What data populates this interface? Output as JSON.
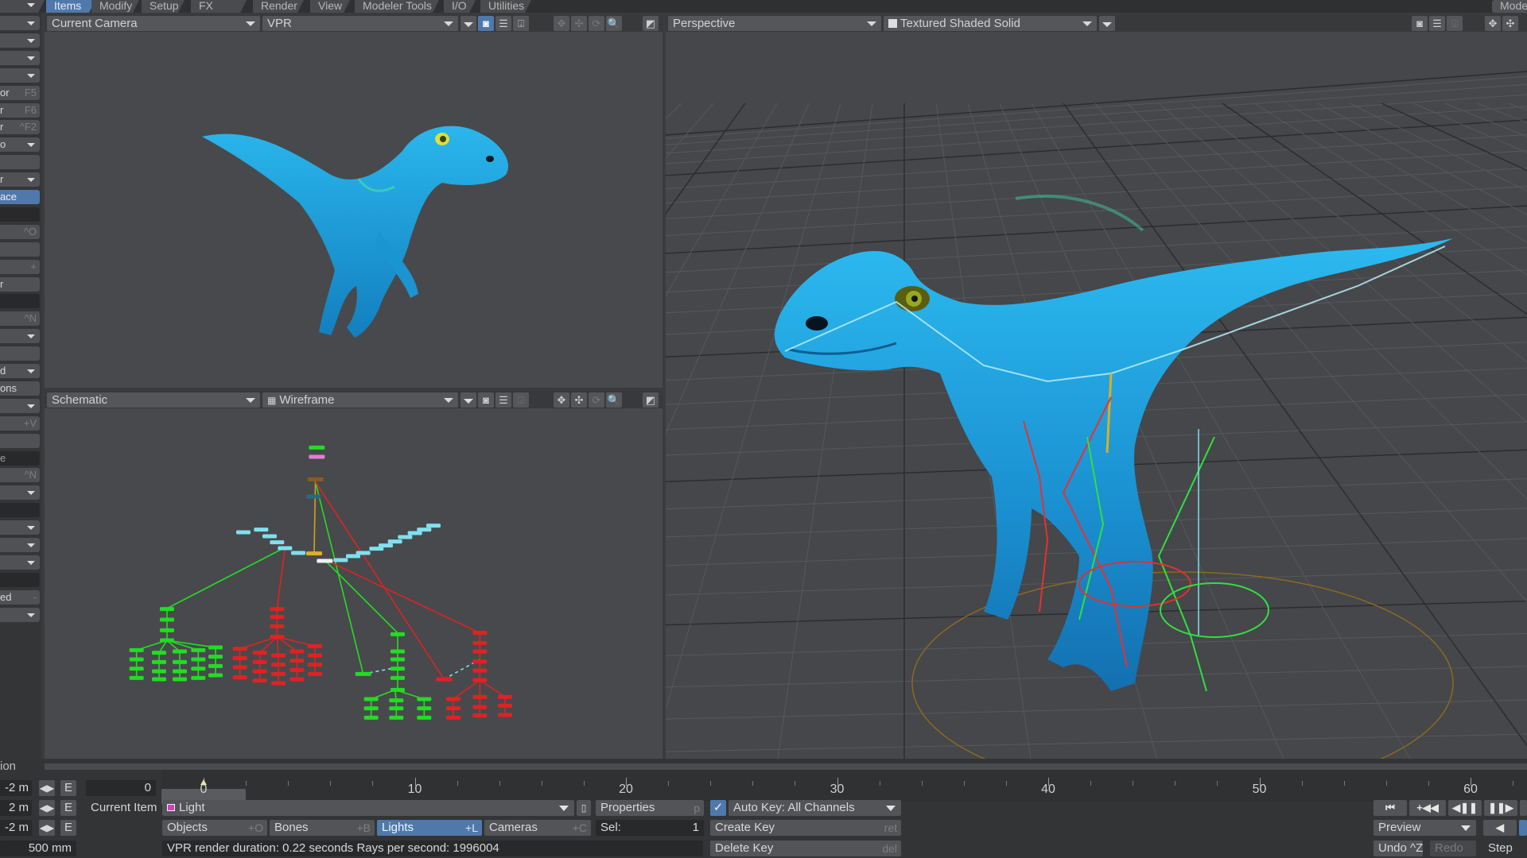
{
  "menu": {
    "tabs": [
      "Items",
      "Modify",
      "Setup",
      "FX Tools",
      "Render",
      "View",
      "Modeler Tools",
      "I/O",
      "Utilities"
    ],
    "active_tab": "Items",
    "right_label": "Modeler"
  },
  "sidebar": {
    "items": [
      {
        "label": "",
        "type": "dropdown"
      },
      {
        "label": "",
        "type": "dropdown"
      },
      {
        "label": "",
        "type": "dropdown"
      },
      {
        "label": "",
        "type": "dropdown"
      },
      {
        "label": "or",
        "shortcut": "F5"
      },
      {
        "label": "r",
        "shortcut": "F6"
      },
      {
        "label": "r",
        "shortcut": "^F2"
      },
      {
        "label": "o",
        "type": "dropdown"
      },
      {
        "label": ""
      },
      {
        "label": "r",
        "type": "dropdown"
      },
      {
        "label": "ace",
        "type": "active"
      },
      {
        "label": "",
        "type": "header"
      },
      {
        "label": "",
        "shortcut": "^O"
      },
      {
        "label": ""
      },
      {
        "label": "",
        "shortcut": "+"
      },
      {
        "label": "r"
      },
      {
        "label": "",
        "type": "header"
      },
      {
        "label": "",
        "shortcut": "^N"
      },
      {
        "label": "",
        "type": "dropdown"
      },
      {
        "label": ""
      },
      {
        "label": "d",
        "type": "dropdown"
      },
      {
        "label": "ons"
      },
      {
        "label": "",
        "type": "dropdown"
      },
      {
        "label": "",
        "shortcut": "+V"
      },
      {
        "label": ""
      },
      {
        "label": "e",
        "type": "header"
      },
      {
        "label": "",
        "shortcut": "^N"
      },
      {
        "label": "",
        "type": "dropdown"
      },
      {
        "label": "",
        "type": "header"
      },
      {
        "label": "",
        "type": "dropdown"
      },
      {
        "label": "",
        "type": "dropdown"
      },
      {
        "label": "",
        "type": "dropdown"
      },
      {
        "label": "",
        "type": "header"
      },
      {
        "label": "ed",
        "shortcut": "-"
      },
      {
        "label": "",
        "type": "dropdown"
      }
    ],
    "bottom_label": "ion"
  },
  "viewports": {
    "top_left": {
      "view": "Current Camera",
      "mode": "VPR"
    },
    "bottom_left": {
      "view": "Schematic",
      "mode": "Wireframe"
    },
    "right": {
      "view": "Perspective",
      "mode": "Textured Shaded Solid"
    }
  },
  "icons": {
    "camera": "◙",
    "list": "☰",
    "save": "⍗",
    "move": "✥",
    "pan": "✣",
    "rotate": "⟳",
    "zoom": "🔍",
    "maximize": "◩"
  },
  "timeline": {
    "current_frame": "0",
    "frame_field": "0",
    "ticks": [
      "0",
      "10",
      "20",
      "30",
      "40",
      "50",
      "60"
    ]
  },
  "position_rows": [
    {
      "value": "-2 m",
      "e": "E"
    },
    {
      "value": "2 m",
      "e": "E"
    },
    {
      "value": "-2 m",
      "e": "E"
    }
  ],
  "grid_size": "500 mm",
  "current_item": {
    "label": "Current Item",
    "value": "Light",
    "properties_label": "Properties",
    "properties_shortcut": "p"
  },
  "item_types": [
    {
      "label": "Objects",
      "shortcut": "+O",
      "active": false
    },
    {
      "label": "Bones",
      "shortcut": "+B",
      "active": false
    },
    {
      "label": "Lights",
      "shortcut": "+L",
      "active": true
    },
    {
      "label": "Cameras",
      "shortcut": "+C",
      "active": false
    }
  ],
  "selection": {
    "label": "Sel:",
    "count": "1"
  },
  "status": "VPR render duration: 0.22 seconds  Rays per second: 1996004",
  "keys": {
    "auto_key_checked": true,
    "auto_key_label": "Auto Key: All Channels",
    "create_key": "Create Key",
    "create_key_shortcut": "ret",
    "delete_key": "Delete Key",
    "delete_key_shortcut": "del"
  },
  "playback": {
    "buttons": [
      "⏮",
      "+◀◀",
      "◀❚❚",
      "❚❚▶"
    ],
    "preview_label": "Preview",
    "undo_label": "Undo ^Z",
    "redo_label": "Redo",
    "step_label": "Step"
  },
  "colors": {
    "accent": "#4f79ac",
    "bone_green": "#22dd22",
    "bone_red": "#e02222",
    "bone_cyan": "#7fe0ee",
    "dino_blue": "#1aa0d8"
  }
}
